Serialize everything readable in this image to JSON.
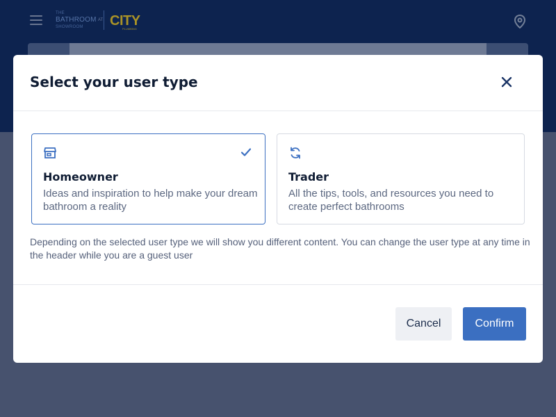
{
  "header": {
    "logo": {
      "the": "THE",
      "bathroom": "BATHROOM",
      "showroom": "SHOWROOM",
      "at": "AT",
      "city": "CITY",
      "city_sub": "PLUMBING"
    },
    "menu_icon": "hamburger-icon",
    "location_icon": "map-pin-icon"
  },
  "modal": {
    "title": "Select your user type",
    "close_icon": "close-icon",
    "options": [
      {
        "title": "Homeowner",
        "description": "Ideas and inspiration to help make your dream bathroom a reality",
        "icon": "storefront-icon",
        "selected": true
      },
      {
        "title": "Trader",
        "description": "All the tips, tools, and resources you need to create perfect bathrooms",
        "icon": "refresh-icon",
        "selected": false
      }
    ],
    "info_text": "Depending on the selected user type we will show you different content. You can change the user type at any time in the header while you are a guest user",
    "cancel_label": "Cancel",
    "confirm_label": "Confirm"
  },
  "colors": {
    "accent": "#3b6fc1",
    "header_bg": "#0d2452",
    "backdrop": "#4a5672",
    "title_text": "#0f1c33",
    "muted_text": "#5b6780"
  }
}
